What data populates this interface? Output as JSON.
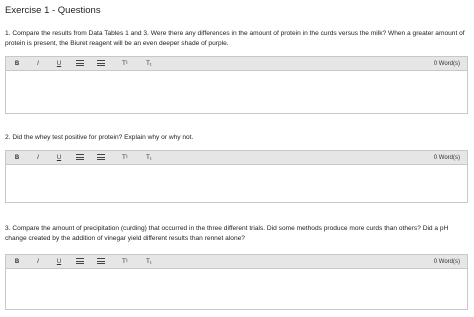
{
  "title": "Exercise 1 - Questions",
  "questions": [
    {
      "text": "1. Compare the results from Data Tables 1 and 3. Were there any differences in the amount of protein in the curds versus the milk? When a greater amount of protein is present, the Biuret reagent will be an even deeper shade of purple.",
      "word_count": "0 Word(s)"
    },
    {
      "text": "2. Did the whey test positive for protein? Explain why or why not.",
      "word_count": "0 Word(s)"
    },
    {
      "text": "3. Compare the amount of precipitation (curding) that occurred in the three different trials. Did some methods produce more curds than others? Did a pH change created by the addition of vinegar yield different results than rennet alone?",
      "word_count": "0 Word(s)"
    }
  ],
  "toolbar": {
    "bold": "B",
    "italic": "I",
    "underline": "U",
    "superscript": "T¹",
    "subscript": "T₁"
  },
  "icons": {
    "bulleted_list": "bulleted-list-icon",
    "numbered_list": "numbered-list-icon"
  }
}
